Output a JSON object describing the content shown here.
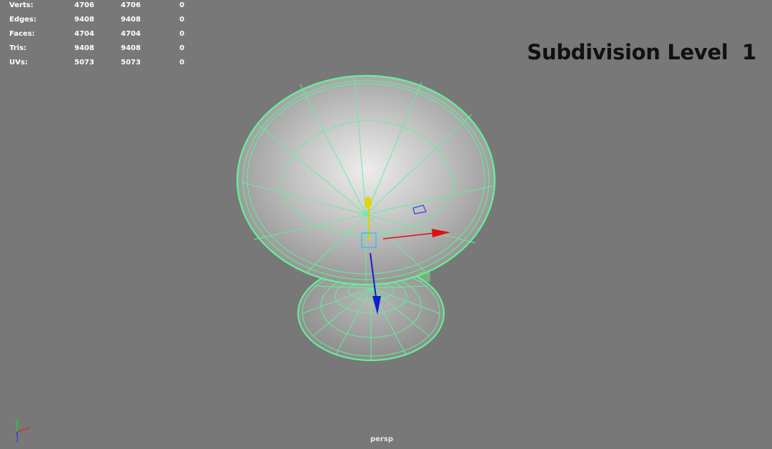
{
  "hud": {
    "rows": [
      {
        "label": "Verts:",
        "c1": "4706",
        "c2": "4706",
        "c3": "0"
      },
      {
        "label": "Edges:",
        "c1": "9408",
        "c2": "9408",
        "c3": "0"
      },
      {
        "label": "Faces:",
        "c1": "4704",
        "c2": "4704",
        "c3": "0"
      },
      {
        "label": "Tris:",
        "c1": "9408",
        "c2": "9408",
        "c3": "0"
      },
      {
        "label": "UVs:",
        "c1": "5073",
        "c2": "5073",
        "c3": "0"
      }
    ]
  },
  "overlay": {
    "title": "Subdivision Level  1"
  },
  "viewport": {
    "camera": "persp"
  },
  "axis_indicator": {
    "x_label": "x",
    "y_label": "y",
    "z_label": "z"
  },
  "colors": {
    "background": "#787878",
    "wireframe": "#66ee99",
    "x_axis": "#e01010",
    "y_axis": "#e0d000",
    "z_axis": "#1020d0"
  },
  "icons": [
    "move-manipulator-icon",
    "axis-orientation-icon"
  ]
}
